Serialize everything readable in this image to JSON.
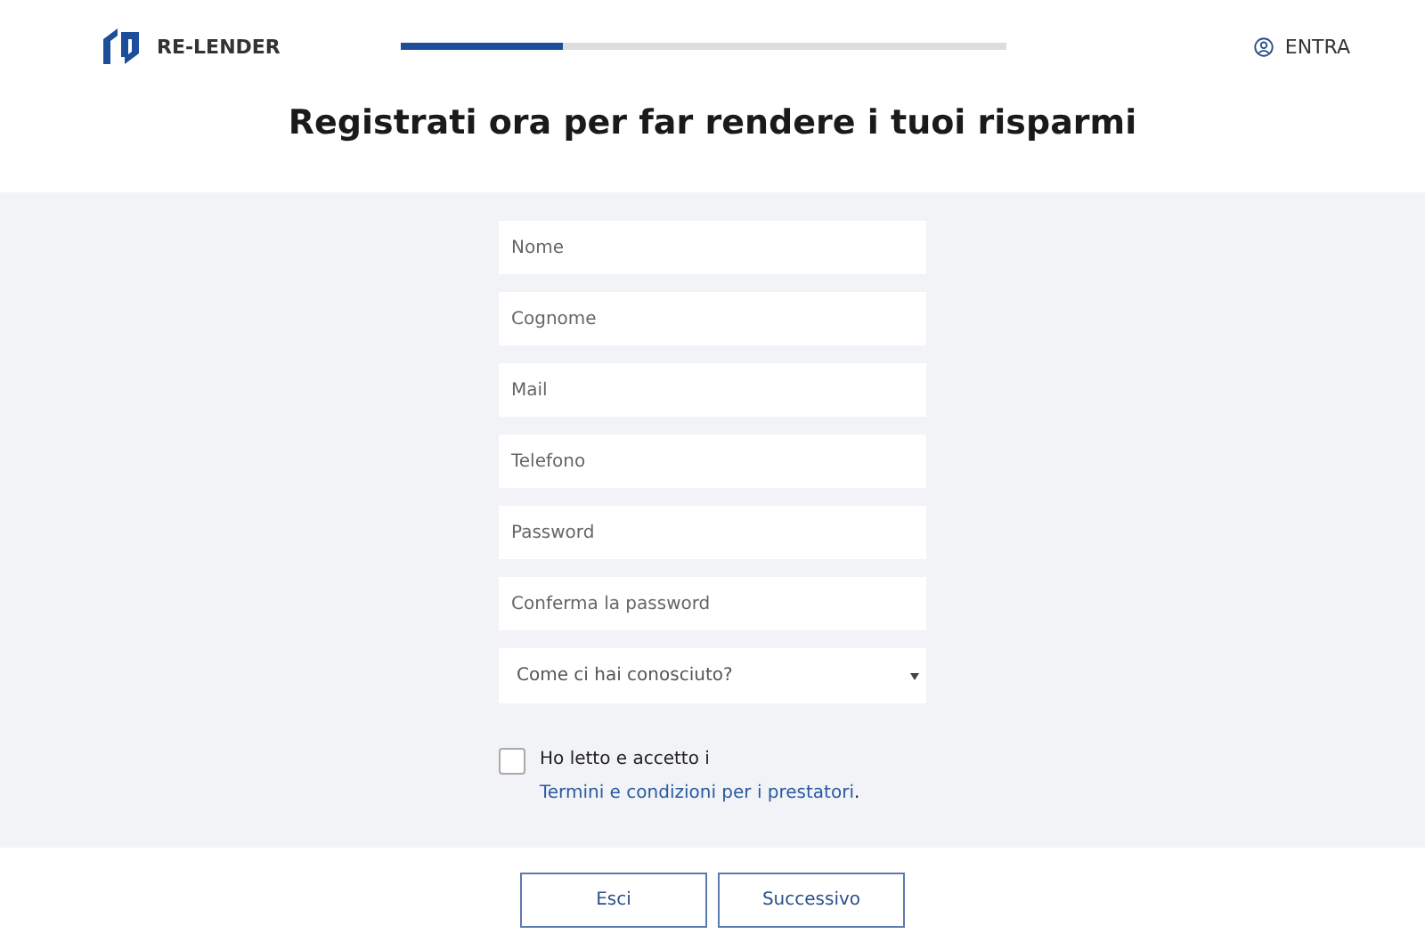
{
  "header": {
    "logo": "RE-LENDER",
    "progress": {
      "level": 0.265
    },
    "login": "ENTRA"
  },
  "title": "Registrati ora per far rendere i tuoi risparmi",
  "fields": [
    {
      "kind": "text",
      "placeholder": "Nome"
    },
    {
      "kind": "text",
      "placeholder": "Cognome"
    },
    {
      "kind": "text",
      "placeholder": "Mail"
    },
    {
      "kind": "text",
      "placeholder": "Telefono"
    },
    {
      "kind": "password",
      "placeholder": "Password"
    },
    {
      "kind": "password",
      "placeholder": "Conferma la password"
    },
    {
      "kind": "select",
      "placeholder": "Come ci hai conosciuto?"
    }
  ],
  "terms": {
    "checked": false,
    "text": "Ho letto e accetto i",
    "link": "Termini e condizioni per i prestatori",
    "end": "."
  },
  "buttons": [
    "Esci",
    "Successivo"
  ]
}
